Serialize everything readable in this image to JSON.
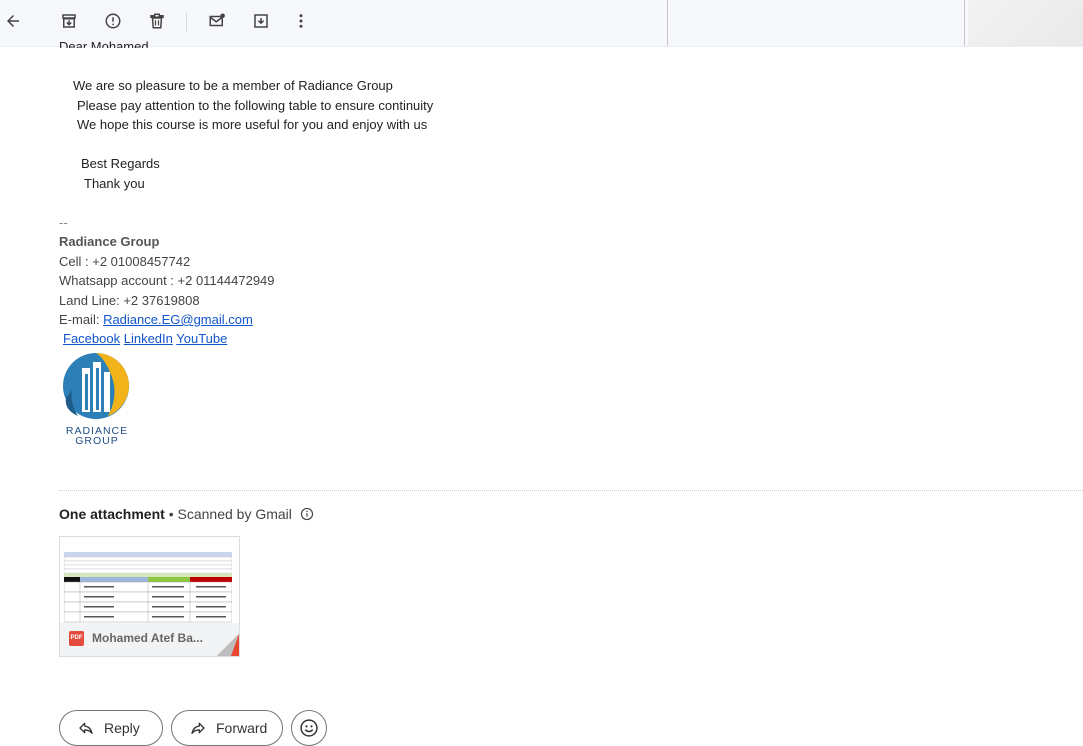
{
  "email": {
    "greeting": "Dear Mohamed",
    "paragraphs": [
      "We are so pleasure to be a member of Radiance Group",
      "Please pay attention to the following table to ensure continuity",
      "We hope this course is more useful for you and enjoy with us"
    ],
    "closing": [
      "Best Regards",
      "Thank you"
    ]
  },
  "signature": {
    "dash": "--",
    "company": "Radiance Group",
    "cell": "Cell : +2 01008457742",
    "whatsapp": "Whatsapp account : +2 01144472949",
    "landline": "Land Line: +2 37619808",
    "email_label": "E-mail: ",
    "email_link": "Radiance.EG@gmail.com",
    "links": [
      "Facebook",
      "LinkedIn",
      "YouTube "
    ],
    "logo_text_1": "RADIANCE",
    "logo_text_2": "GROUP"
  },
  "attachments": {
    "heading": "One attachment",
    "scanned": " • Scanned by Gmail",
    "file_name": "Mohamed Atef Ba...",
    "badge": "PDF"
  },
  "actions": {
    "reply": "Reply",
    "forward": "Forward"
  },
  "icons": {
    "toolbar": [
      "back-arrow-icon",
      "archive-icon",
      "report-spam-icon",
      "delete-icon",
      "mark-unread-icon",
      "move-to-icon",
      "more-vert-icon"
    ]
  },
  "colors": {
    "link": "#1155cc",
    "pdf_red": "#e34b3c",
    "logo_blue": "#1f6fa8",
    "logo_gold": "#f2b21a"
  }
}
